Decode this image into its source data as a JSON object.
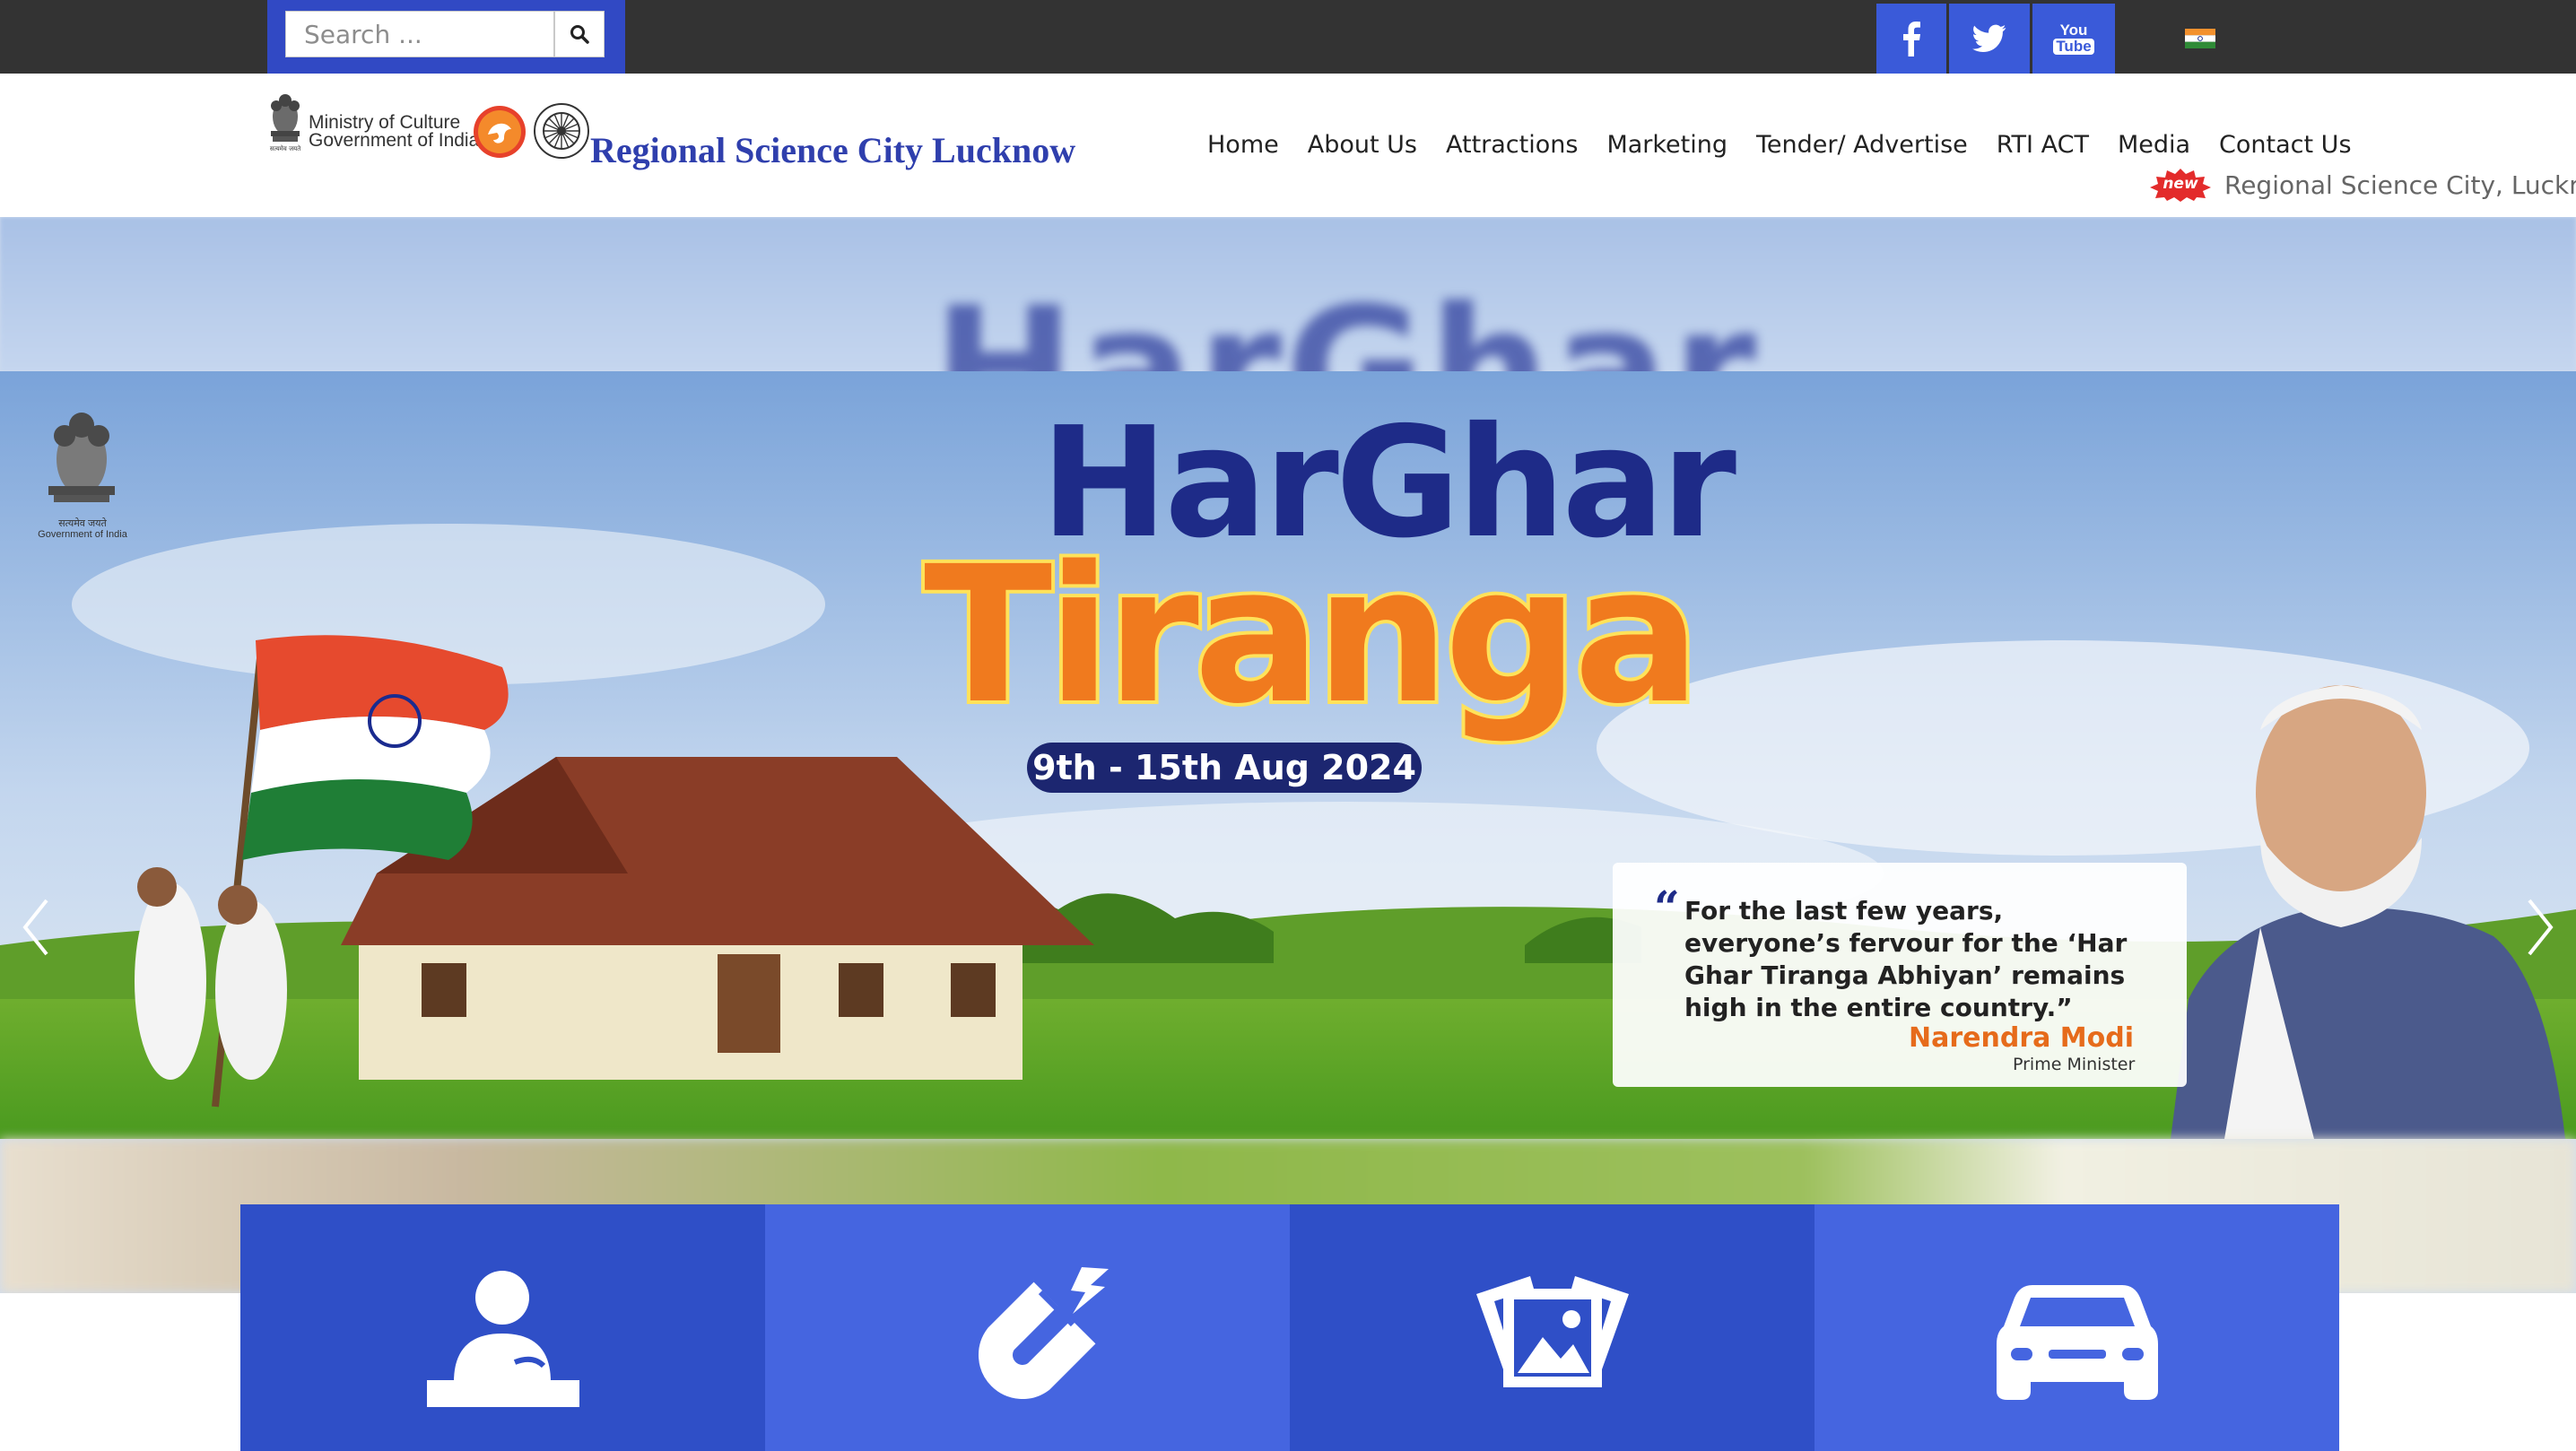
{
  "topbar": {
    "search": {
      "placeholder": "Search ..."
    },
    "social": [
      {
        "icon": "facebook-icon"
      },
      {
        "icon": "twitter-icon"
      },
      {
        "icon": "youtube-icon",
        "label_top": "You",
        "label_bottom": "Tube"
      }
    ],
    "language_flag": "india-flag-icon"
  },
  "header": {
    "ministry_line1": "Ministry of Culture",
    "ministry_line2": "Government of India",
    "site_title": "Regional Science City Lucknow",
    "nav": [
      "Home",
      "About Us",
      "Attractions",
      "Marketing",
      "Tender/ Advertise",
      "RTI ACT",
      "Media",
      "Contact Us"
    ],
    "ticker_badge": "new",
    "ticker_text": "Regional Science City, Lucknow"
  },
  "hero": {
    "blur_word": "HarGhar",
    "emblem_caption_line1": "सत्यमेव जयते",
    "emblem_caption_line2": "Government of India",
    "title_line1": "HarGhar",
    "title_line2": "Tiranga",
    "date_text": "9th - 15th Aug 2024",
    "quote_open": "“",
    "quote_text": "For the last few years, everyone’s fervour for the ‘Har Ghar Tiranga Abhiyan’ remains high in the entire country.”",
    "quote_author": "Narendra Modi",
    "quote_role": "Prime Minister"
  },
  "tiles": [
    {
      "icon": "visitor-desk-icon",
      "color": "#2f4fc7"
    },
    {
      "icon": "magnet-icon",
      "color": "#4565e0"
    },
    {
      "icon": "gallery-icon",
      "color": "#2f4fc7"
    },
    {
      "icon": "car-icon",
      "color": "#4565e0"
    }
  ],
  "colors": {
    "accent_blue": "#3149c4",
    "topbar": "#333333",
    "title_blue": "#2f3fad",
    "saffron": "#f07a1e"
  }
}
